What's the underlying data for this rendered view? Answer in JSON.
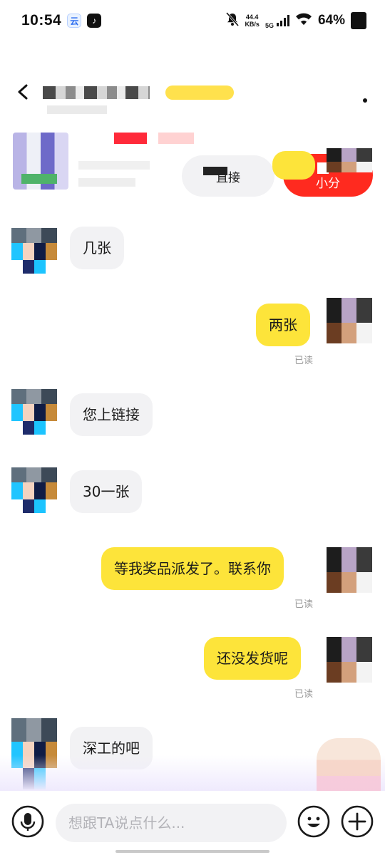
{
  "status_bar": {
    "time": "10:54",
    "net_speed_value": "44.4",
    "net_speed_unit": "KB/s",
    "network": "5G",
    "battery": "64%"
  },
  "header": {
    "direct_button_label": "直接",
    "small_button_label": "小分"
  },
  "messages": [
    {
      "side": "in",
      "text": "几张"
    },
    {
      "side": "out",
      "text": "两张",
      "status": "已读"
    },
    {
      "side": "in",
      "text": "您上链接"
    },
    {
      "side": "in",
      "text": "30一张"
    },
    {
      "side": "out",
      "text": "等我奖品派发了。联系你",
      "status": "已读"
    },
    {
      "side": "out",
      "text": "还没发货呢",
      "status": "已读"
    },
    {
      "side": "in",
      "text": "深工的吧"
    }
  ],
  "input": {
    "placeholder": "想跟TA说点什么..."
  },
  "colors": {
    "outgoing_bubble": "#fde43a",
    "incoming_bubble": "#f2f2f4",
    "accent_red": "#ff2a1f"
  }
}
